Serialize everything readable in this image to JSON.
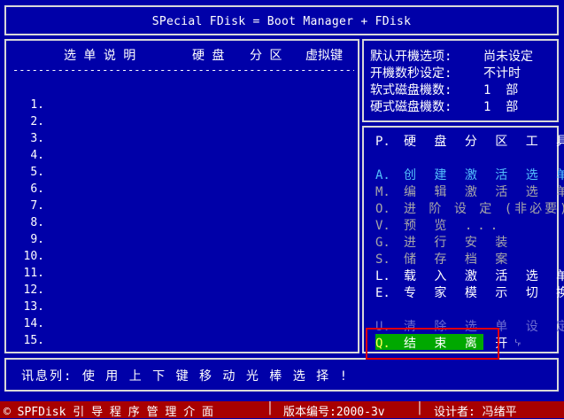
{
  "title": "SPecial FDisk = Boot Manager + FDisk",
  "menu": {
    "headers": [
      "选 单 说 明",
      "硬 盘",
      "分 区",
      "虚拟键"
    ],
    "divider": "-----------------------------------------------------------",
    "numbers": [
      "1.",
      "2.",
      "3.",
      "4.",
      "5.",
      "6.",
      "7.",
      "8.",
      "9.",
      "10.",
      "11.",
      "12.",
      "13.",
      "14.",
      "15."
    ]
  },
  "info": {
    "rows": [
      {
        "label": "默认开機选项:",
        "value": "尚未设定"
      },
      {
        "label": "开機数秒设定:",
        "value": "不计时"
      },
      {
        "label": "软式磁盘機数:",
        "value": "1  部"
      },
      {
        "label": "硬式磁盘機数:",
        "value": "1  部"
      }
    ]
  },
  "tools": {
    "heading": {
      "key": "P.",
      "label": "硬 盘 分 区 工 具"
    },
    "items": [
      {
        "key": "A.",
        "label": "创 建 激 活 选 单",
        "state": "cyan"
      },
      {
        "key": "M.",
        "label": "编 辑 激 活 选 单",
        "state": "gray"
      },
      {
        "key": "O.",
        "label": "进 阶 设 定 (非必要)",
        "state": "gray"
      },
      {
        "key": "V.",
        "label": "预 览 ...",
        "state": "gray"
      },
      {
        "key": "G.",
        "label": "进 行 安 装",
        "state": "gray"
      },
      {
        "key": "S.",
        "label": "储 存 档 案",
        "state": "gray"
      },
      {
        "key": "L.",
        "label": "载 入 激 活 选 单",
        "state": "white"
      },
      {
        "key": "E.",
        "label": "专 家 模 示 切 换",
        "state": "white"
      },
      {
        "key": "U.",
        "label": "清 除 选 单 设 定",
        "state": "dim"
      }
    ],
    "selected": {
      "key": "Q.",
      "label": "结 束 离 开"
    }
  },
  "message": "讯息列: 使 用 上 下 键 移 动 光 棒 选 择 !",
  "status": {
    "app": "© SPFDisk 引 导 程 序 管 理 介 面",
    "version": "版本编号:2000-3v",
    "author": "设计者: 冯绪平"
  },
  "colors": {
    "background": "#0000a8",
    "highlight": "#00a800",
    "status_bar": "#a80000",
    "annotation": "#e00000"
  }
}
